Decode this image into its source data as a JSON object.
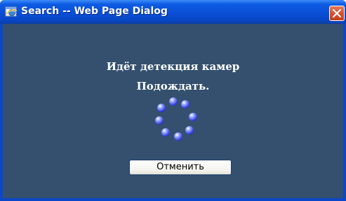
{
  "window": {
    "title": "Search -- Web Page Dialog",
    "titlebar_color": "#0a4fd6",
    "close_color": "#d8502d"
  },
  "dialog": {
    "background": "#34506e",
    "message_line1": "Идёт детекция камер",
    "message_line2": "Подождать.",
    "spinner_icon": "loading-spinner-icon",
    "cancel_label": "Отменить"
  }
}
